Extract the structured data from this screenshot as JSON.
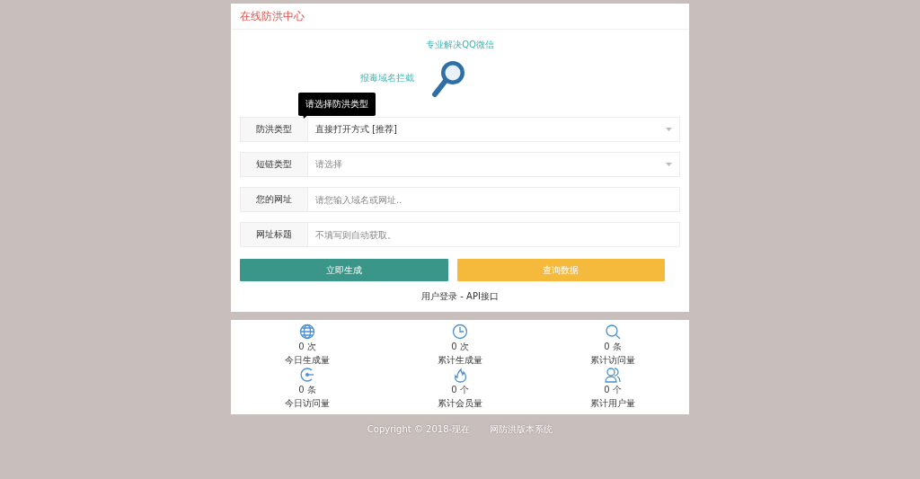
{
  "header": {
    "title": "在线防洪中心"
  },
  "logo": {
    "tagline": "专业解决QQ微信",
    "subtitle": "报毒域名拦截"
  },
  "tooltip": "请选择防洪类型",
  "fields": [
    {
      "kind": "select",
      "label": "防洪类型",
      "value": "直接打开方式 [推荐]"
    },
    {
      "kind": "select",
      "label": "短链类型",
      "placeholder": "请选择"
    },
    {
      "kind": "input",
      "label": "您的网址",
      "placeholder": "请您输入域名或网址.."
    },
    {
      "kind": "input",
      "label": "网址标题",
      "placeholder": "不填写则自动获取。"
    }
  ],
  "buttons": [
    {
      "kind": "primary",
      "label": "立即生成"
    },
    {
      "kind": "warning",
      "label": "查询数据"
    }
  ],
  "links": [
    "用户登录 - API接口"
  ],
  "stats": [
    {
      "value": "0 次",
      "label": "今日生成量"
    },
    {
      "value": "0 次",
      "label": "累计生成量"
    },
    {
      "value": "0 条",
      "label": "累计访问量"
    },
    {
      "value": "0 条",
      "label": "今日访问量"
    },
    {
      "value": "0 个",
      "label": "累计会员量"
    },
    {
      "value": "0 个",
      "label": "累计用户量"
    }
  ],
  "footer": {
    "copyright": "Copyright © 2018-现在",
    "system": "网防洪版本系统"
  }
}
